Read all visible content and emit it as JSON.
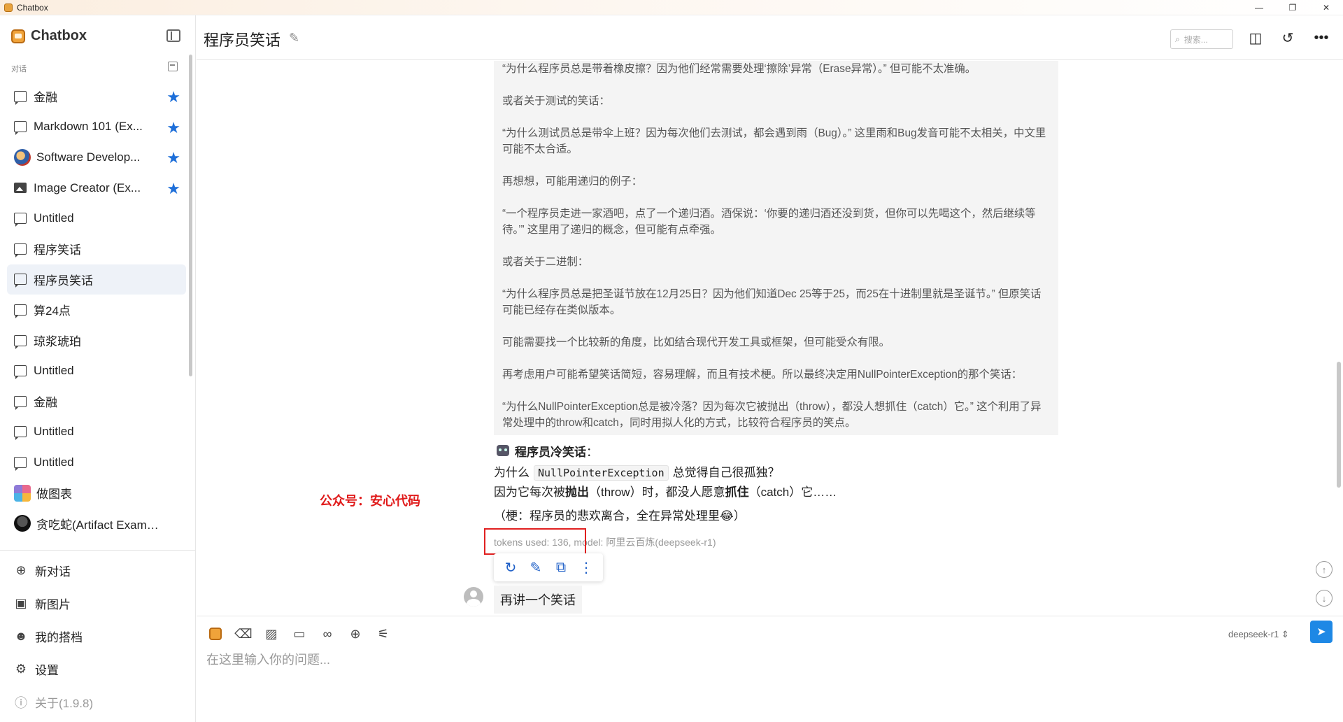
{
  "window": {
    "title": "Chatbox",
    "controls": [
      "—",
      "❐",
      "✕"
    ]
  },
  "sidebar": {
    "brand": "Chatbox",
    "section_label": "对话",
    "conversations": [
      {
        "label": "金融",
        "starred": true,
        "icon": "chat-icon"
      },
      {
        "label": "Markdown 101 (Ex...",
        "starred": true,
        "icon": "chat-icon"
      },
      {
        "label": "Software Develop...",
        "starred": true,
        "icon": "avatar"
      },
      {
        "label": "Image Creator (Ex...",
        "starred": true,
        "icon": "image-icon"
      },
      {
        "label": "Untitled",
        "starred": false,
        "icon": "chat-icon"
      },
      {
        "label": "程序笑话",
        "starred": false,
        "icon": "chat-icon"
      },
      {
        "label": "程序员笑话",
        "starred": false,
        "icon": "chat-icon",
        "active": true
      },
      {
        "label": "算24点",
        "starred": false,
        "icon": "chat-icon"
      },
      {
        "label": "琼浆琥珀",
        "starred": false,
        "icon": "chat-icon"
      },
      {
        "label": "Untitled",
        "starred": false,
        "icon": "chat-icon"
      },
      {
        "label": "金融",
        "starred": false,
        "icon": "chat-icon"
      },
      {
        "label": "Untitled",
        "starred": false,
        "icon": "chat-icon"
      },
      {
        "label": "Untitled",
        "starred": false,
        "icon": "chat-icon"
      },
      {
        "label": "做图表",
        "starred": false,
        "icon": "chart-avatar"
      },
      {
        "label": "贪吃蛇(Artifact Example)",
        "starred": false,
        "icon": "dark-avatar"
      }
    ],
    "actions": {
      "new_chat": "新对话",
      "new_image": "新图片",
      "my_copilots": "我的搭档",
      "settings": "设置",
      "about": "关于(1.9.8)"
    }
  },
  "header": {
    "title": "程序员笑话",
    "search_placeholder": "搜索..."
  },
  "chat": {
    "thinking_paragraphs": [
      "“为什么程序员总是带着橡皮擦？因为他们经常需要处理‘擦除’异常（Erase异常）。” 但可能不太准确。",
      "或者关于测试的笑话：",
      "“为什么测试员总是带伞上班？因为每次他们去测试，都会遇到雨（Bug）。” 这里雨和Bug发音可能不太相关，中文里可能不太合适。",
      "再想想，可能用递归的例子：",
      "“一个程序员走进一家酒吧，点了一个递归酒。酒保说：‘你要的递归酒还没到货，但你可以先喝这个，然后继续等待。’” 这里用了递归的概念，但可能有点牵强。",
      "或者关于二进制：",
      "“为什么程序员总是把圣诞节放在12月25日？因为他们知道Dec 25等于25，而25在十进制里就是圣诞节。” 但原笑话可能已经存在类似版本。",
      "可能需要找一个比较新的角度，比如结合现代开发工具或框架，但可能受众有限。",
      "再考虑用户可能希望笑话简短，容易理解，而且有技术梗。所以最终决定用NullPointerException的那个笑话：",
      "“为什么NullPointerException总是被冷落？因为每次它被抛出（throw），都没人想抓住（catch）它。” 这个利用了异常处理中的throw和catch，同时用拟人化的方式，比较符合程序员的笑点。"
    ],
    "reply": {
      "heading": "程序员冷笑话",
      "heading_suffix": "：",
      "line1_pre": "为什么",
      "line1_code": "NullPointerException",
      "line1_post": "总觉得自己很孤独？",
      "line2_pre": "因为它每次被",
      "line2_bold1": "抛出",
      "line2_mid": "（throw）时，都没人愿意",
      "line2_bold2": "抓住",
      "line2_post": "（catch）它……",
      "note": "（梗：程序员的悲欢离合，全在异常处理里😂）"
    },
    "meta": {
      "tokens": "tokens used: 136,",
      "model": " model: 阿里云百炼(deepseek-r1)"
    },
    "watermark": "公众号：安心代码",
    "user_message": "再讲一个笑话"
  },
  "input": {
    "placeholder": "在这里输入你的问题...",
    "model": "deepseek-r1 ⇕"
  },
  "colors": {
    "accent": "#1e88e5",
    "star": "#1e6fd9",
    "highlight": "#e02020",
    "watermark": "#e01b1b"
  }
}
